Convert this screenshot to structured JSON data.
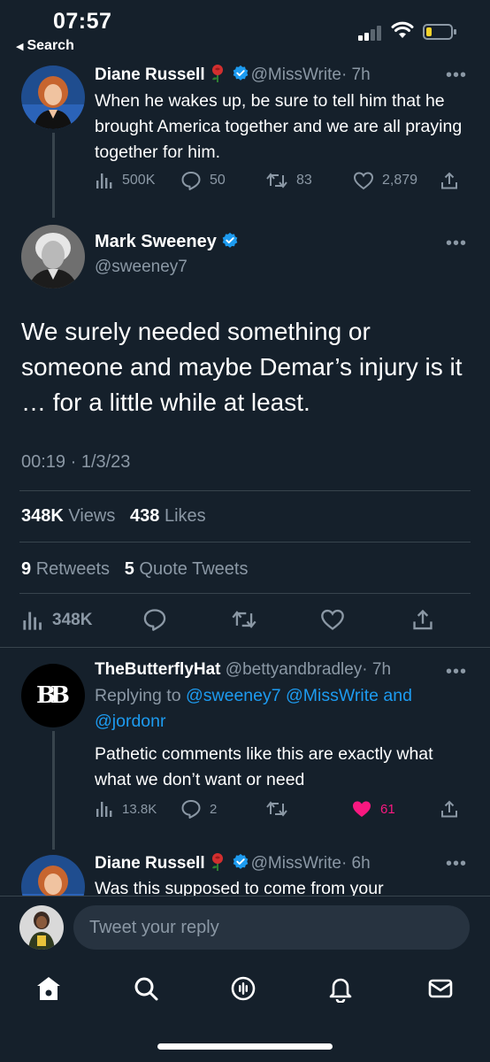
{
  "status_bar": {
    "time": "07:57",
    "back_label": "Search"
  },
  "tweets": [
    {
      "name": "Diane Russell",
      "handle": "@MissWrite",
      "age": "· 7h",
      "text": "When he wakes up, be sure to tell him that he brought America together and we are all praying together for him.",
      "views": "500K",
      "replies": "50",
      "retweets": "83",
      "likes": "2,879"
    },
    {
      "name": "TheButterflyHat",
      "handle": "@bettyandbradley",
      "age": "· 7h",
      "replying_prefix": "Replying to",
      "replying_targets": "@sweeney7 @MissWrite and",
      "replying_targets_2": "@jordonr",
      "text": "Pathetic comments like this are exactly what what we don’t want or need",
      "views": "13.8K",
      "replies": "2",
      "likes": "61",
      "liked_color": "#f91880"
    },
    {
      "name": "Diane Russell",
      "handle": "@MissWrite",
      "age": "· 6h",
      "text": "Was this supposed to come from your"
    }
  ],
  "main_tweet": {
    "name": "Mark Sweeney",
    "handle": "@sweeney7",
    "text": "We surely needed something or someone and maybe Demar’s injury is it … for a little while at least.",
    "timestamp": "00:19 · 1/3/23",
    "views_count": "348K",
    "views_label": "Views",
    "likes_count": "438",
    "likes_label": "Likes",
    "retweets_count": "9",
    "retweets_label": "Retweets",
    "quotes_count": "5",
    "quotes_label": "Quote Tweets",
    "action_views": "348K"
  },
  "reply_bar": {
    "placeholder": "Tweet your reply"
  },
  "avatar_monogram": "BB",
  "more_label": "•••",
  "colors": {
    "background": "#15202b",
    "accent": "#1d9bf0",
    "muted": "#8b98a5",
    "like": "#f91880",
    "verified": "#1d9bf0"
  },
  "icons": [
    "home-icon",
    "search-icon",
    "spaces-icon",
    "notifications-icon",
    "messages-icon"
  ]
}
